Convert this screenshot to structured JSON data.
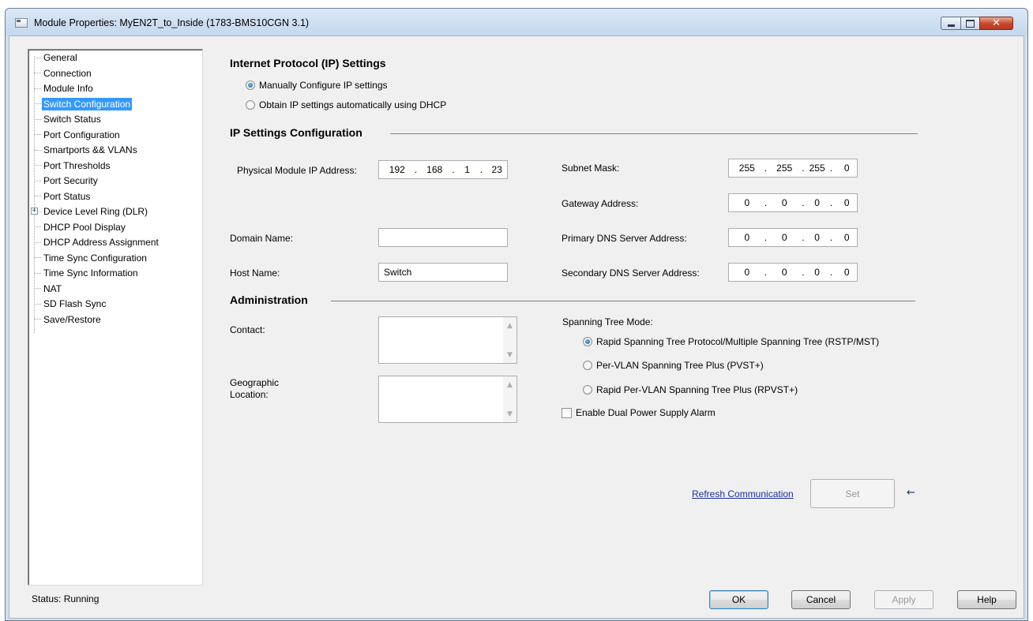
{
  "window": {
    "title": "Module Properties: MyEN2T_to_Inside (1783-BMS10CGN 3.1)",
    "close_glyph": "✕"
  },
  "tree": {
    "items": [
      {
        "label": "General"
      },
      {
        "label": "Connection"
      },
      {
        "label": "Module Info"
      },
      {
        "label": "Switch Configuration",
        "selected": true
      },
      {
        "label": "Switch Status"
      },
      {
        "label": "Port Configuration"
      },
      {
        "label": "Smartports && VLANs"
      },
      {
        "label": "Port Thresholds"
      },
      {
        "label": "Port Security"
      },
      {
        "label": "Port Status"
      },
      {
        "label": "Device Level Ring (DLR)",
        "expander": "+"
      },
      {
        "label": "DHCP Pool Display"
      },
      {
        "label": "DHCP Address Assignment"
      },
      {
        "label": "Time Sync Configuration"
      },
      {
        "label": "Time Sync Information"
      },
      {
        "label": "NAT"
      },
      {
        "label": "SD Flash Sync"
      },
      {
        "label": "Save/Restore"
      }
    ]
  },
  "ip_protocol": {
    "title": "Internet Protocol (IP) Settings",
    "manual_label": "Manually Configure IP settings",
    "manual_checked": true,
    "dhcp_label": "Obtain IP settings automatically using DHCP",
    "dhcp_checked": false
  },
  "ip_config": {
    "title": "IP Settings Configuration",
    "ip_label": "Physical Module IP Address:",
    "ip_octets": [
      "192",
      "168",
      "1",
      "23"
    ],
    "domain_label": "Domain Name:",
    "domain_value": "",
    "host_label": "Host Name:",
    "host_value": "Switch",
    "subnet_label": "Subnet Mask:",
    "subnet_octets": [
      "255",
      "255",
      "255",
      "0"
    ],
    "gateway_label": "Gateway Address:",
    "gateway_octets": [
      "0",
      "0",
      "0",
      "0"
    ],
    "dns1_label": "Primary DNS Server Address:",
    "dns1_octets": [
      "0",
      "0",
      "0",
      "0"
    ],
    "dns2_label": "Secondary DNS Server Address:",
    "dns2_octets": [
      "0",
      "0",
      "0",
      "0"
    ],
    "separator": "."
  },
  "admin": {
    "title": "Administration",
    "contact_label": "Contact:",
    "contact_value": "",
    "location_label_line1": "Geographic",
    "location_label_line2": "Location:",
    "location_value": "",
    "stp_label": "Spanning Tree Mode:",
    "stp_options": [
      {
        "label": "Rapid Spanning Tree Protocol/Multiple Spanning Tree (RSTP/MST)",
        "checked": true
      },
      {
        "label": "Per-VLAN Spanning Tree Plus (PVST+)",
        "checked": false
      },
      {
        "label": "Rapid Per-VLAN Spanning Tree Plus (RPVST+)",
        "checked": false
      }
    ],
    "dual_power_label": "Enable Dual Power Supply Alarm",
    "dual_power_checked": false,
    "scroll_up": "▲",
    "scroll_down": "▼"
  },
  "actions": {
    "refresh_label": "Refresh Communication",
    "set_label": "Set",
    "arrow_glyph": "←"
  },
  "footer": {
    "status": "Status:  Running",
    "ok_label": "OK",
    "cancel_label": "Cancel",
    "apply_label": "Apply",
    "help_label": "Help"
  }
}
